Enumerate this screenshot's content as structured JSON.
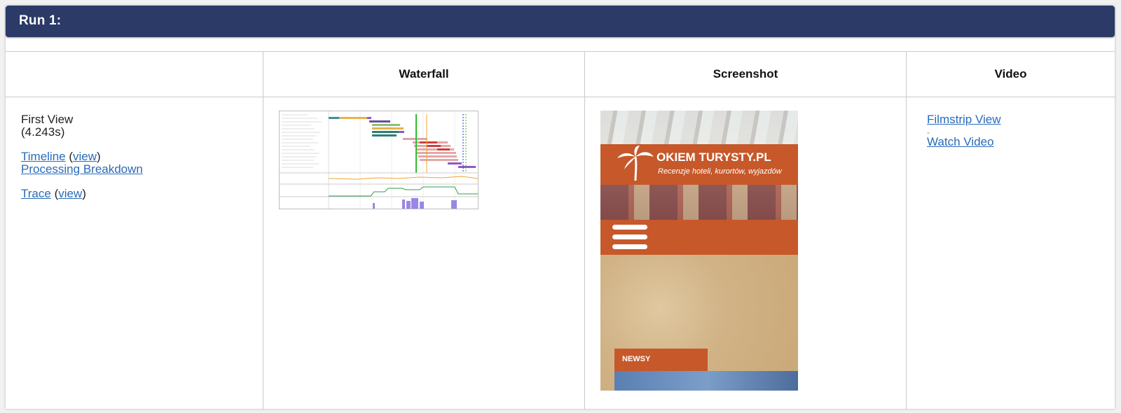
{
  "run": {
    "title": "Run 1:"
  },
  "columns": {
    "waterfall": "Waterfall",
    "screenshot": "Screenshot",
    "video": "Video"
  },
  "first_view": {
    "label": "First View",
    "time": "(4.243s)",
    "timeline": "Timeline",
    "view": "view",
    "processing": "Processing Breakdown",
    "trace": "Trace"
  },
  "video": {
    "filmstrip": "Filmstrip View",
    "separator": "-",
    "watch": "Watch Video"
  },
  "screenshot": {
    "brand": "OKIEM TURYSTY.PL",
    "tagline": "Recenzje hoteli, kurortów, wyjazdów",
    "news": "NEWSY"
  },
  "colors": {
    "header_bg": "#2b3a66",
    "link": "#2a6bb8",
    "site_orange": "#c6582a"
  }
}
